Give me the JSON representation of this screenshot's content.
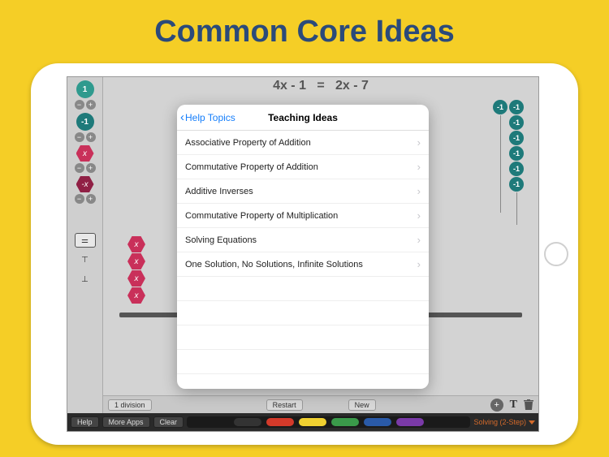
{
  "title": "Common Core Ideas",
  "equation": {
    "left": "4x - 1",
    "eq": "=",
    "right": "2x - 7"
  },
  "palette": {
    "tok_plus1": "1",
    "tok_minus1": "-1",
    "tok_x": "x",
    "tok_negx": "-x",
    "plus": "+",
    "minus": "−"
  },
  "balloons": {
    "label": "-1"
  },
  "midbar": {
    "division": "1 division",
    "restart": "Restart",
    "new": "New",
    "add": "+",
    "text": "T"
  },
  "botbar": {
    "help": "Help",
    "moreapps": "More Apps",
    "clear": "Clear",
    "status": "Solving (2-Step)"
  },
  "marker_colors": [
    "#333333",
    "#d43a2a",
    "#f0d030",
    "#3a9a4a",
    "#2a5aa8",
    "#7a3aa8"
  ],
  "popover": {
    "back": "Help Topics",
    "title": "Teaching Ideas",
    "items": [
      "Associative Property of Addition",
      "Commutative Property of Addition",
      "Additive Inverses",
      "Commutative Property of Multiplication",
      "Solving Equations",
      "One Solution, No Solutions, Infinite Solutions"
    ]
  }
}
